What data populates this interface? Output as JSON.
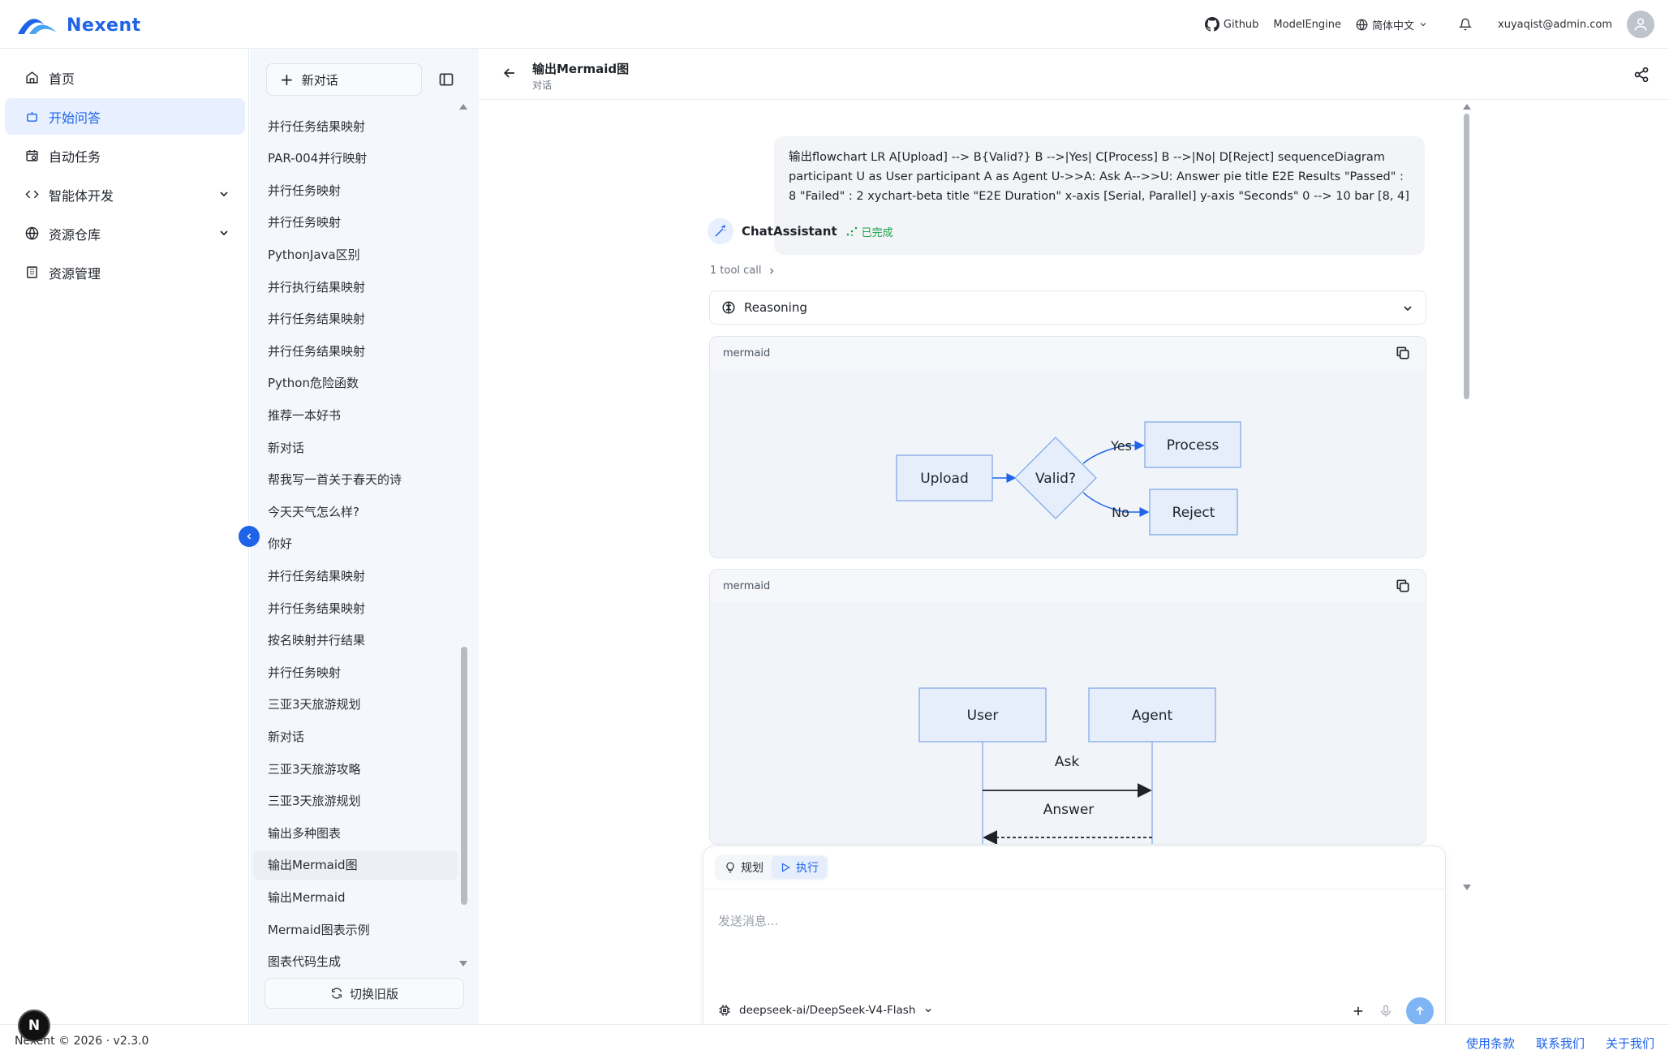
{
  "app": {
    "brand": "Nexent",
    "top_links": {
      "github": "Github",
      "model_engine": "ModelEngine",
      "language": "简体中文",
      "user_email": "xuyaqist@admin.com"
    }
  },
  "leftnav": {
    "items": [
      {
        "label": "首页",
        "icon": "home-icon",
        "active": false,
        "expandable": false
      },
      {
        "label": "开始问答",
        "icon": "bot-icon",
        "active": true,
        "expandable": false
      },
      {
        "label": "自动任务",
        "icon": "calendar-clock-icon",
        "active": false,
        "expandable": false
      },
      {
        "label": "智能体开发",
        "icon": "code-icon",
        "active": false,
        "expandable": true
      },
      {
        "label": "资源仓库",
        "icon": "globe-icon",
        "active": false,
        "expandable": true
      },
      {
        "label": "资源管理",
        "icon": "building-icon",
        "active": false,
        "expandable": false
      }
    ]
  },
  "conversations": {
    "new_chat_label": "新对话",
    "switch_old_label": "切换旧版",
    "items": [
      "并行任务结果映射",
      "PAR-004并行映射",
      "并行任务映射",
      "并行任务映射",
      "PythonJava区别",
      "并行执行结果映射",
      "并行任务结果映射",
      "并行任务结果映射",
      "Python危险函数",
      "推荐一本好书",
      "新对话",
      "帮我写一首关于春天的诗",
      "今天天气怎么样?",
      "你好",
      "并行任务结果映射",
      "并行任务结果映射",
      "按名映射并行结果",
      "并行任务映射",
      "三亚3天旅游规划",
      "新对话",
      "三亚3天旅游攻略",
      "三亚3天旅游规划",
      "输出多种图表",
      "输出Mermaid图",
      "输出Mermaid",
      "Mermaid图表示例",
      "图表代码生成"
    ],
    "selected_index": 23
  },
  "chat": {
    "title": "输出Mermaid图",
    "subtitle": "对话",
    "user_message": "输出flowchart LR A[Upload] --> B{Valid?} B -->|Yes| C[Process] B -->|No| D[Reject] sequenceDiagram participant U as User participant A as Agent U->>A: Ask A-->>U: Answer pie title E2E Results \"Passed\" : 8 \"Failed\" : 2 xychart-beta title \"E2E Duration\" x-axis [Serial, Parallel] y-axis \"Seconds\" 0 --> 10 bar [8, 4]",
    "assistant_name": "ChatAssistant",
    "assistant_status": "已完成",
    "tool_call": "1 tool call",
    "reasoning_label": "Reasoning",
    "code_blocks": [
      {
        "lang": "mermaid",
        "kind": "flowchart",
        "nodes": {
          "upload": "Upload",
          "valid": "Valid?",
          "process": "Process",
          "reject": "Reject"
        },
        "edges": {
          "yes": "Yes",
          "no": "No"
        }
      },
      {
        "lang": "mermaid",
        "kind": "sequence",
        "participants": {
          "user": "User",
          "agent": "Agent"
        },
        "messages": {
          "ask": "Ask",
          "answer": "Answer"
        }
      }
    ]
  },
  "composer": {
    "mode_plan": "规划",
    "mode_execute": "执行",
    "active_mode": "执行",
    "placeholder": "发送消息...",
    "model": "deepseek-ai/DeepSeek-V4-Flash"
  },
  "footer": {
    "copyright": "Nexent © 2026 · v2.3.0",
    "links": {
      "terms": "使用条款",
      "contact": "联系我们",
      "about": "关于我们"
    }
  },
  "colors": {
    "accent": "#1f63e8",
    "active_bg": "#e8f0ff",
    "success": "#17a34a"
  }
}
